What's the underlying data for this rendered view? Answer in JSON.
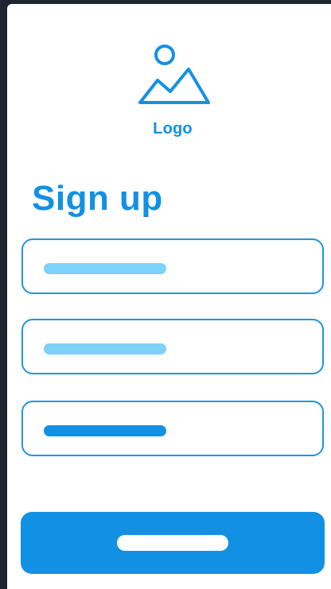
{
  "logo": {
    "icon": "image-placeholder-icon",
    "label": "Logo"
  },
  "form": {
    "title": "Sign up",
    "fields": [
      {
        "name": "field-1",
        "placeholder_style": "light"
      },
      {
        "name": "field-2",
        "placeholder_style": "light"
      },
      {
        "name": "field-3",
        "placeholder_style": "dark"
      }
    ]
  },
  "colors": {
    "accent": "#1291e4",
    "field_border": "#2196db",
    "placeholder_light": "#7dd2fa",
    "background": "#ffffff",
    "frame": "#1e2430"
  }
}
